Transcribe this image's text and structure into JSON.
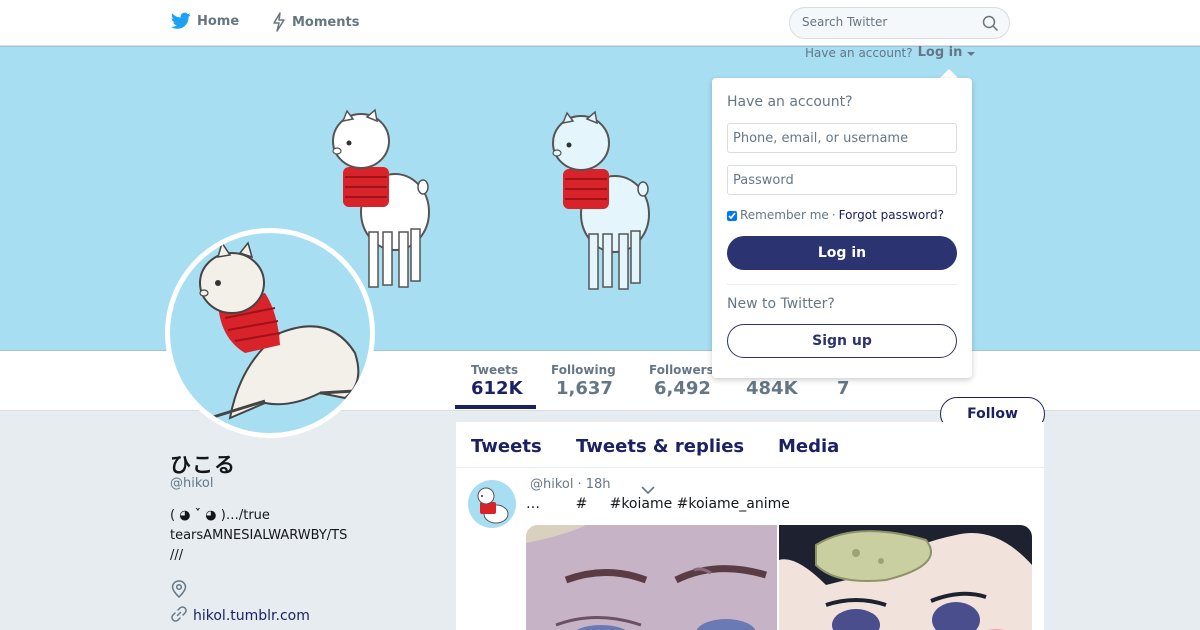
{
  "nav": {
    "home_label": "Home",
    "moments_label": "Moments"
  },
  "search": {
    "placeholder": "Search Twitter"
  },
  "stats": [
    {
      "label": "Tweets",
      "value": "612K"
    },
    {
      "label": "Following",
      "value": "1,637"
    },
    {
      "label": "Followers",
      "value": "6,492"
    },
    {
      "label": "",
      "value": "484K"
    },
    {
      "label": "",
      "value": "7"
    }
  ],
  "follow_label": "Follow",
  "profile": {
    "name": "ひこる",
    "handle": "@hikol",
    "bio_lines": [
      "( ◕ ˊ̀ ◕ )…/true",
      "tearsAMNESIALWARWBY/TS",
      "///"
    ],
    "link": "hikol.tumblr.com"
  },
  "timeline": {
    "tabs": [
      "Tweets",
      "Tweets & replies",
      "Media"
    ],
    "tweet": {
      "handle": "@hikol",
      "time": "· 18h",
      "text": "…        #     #koiame #koiame_anime"
    }
  },
  "login": {
    "prompt": "Have an account?",
    "link": "Log in",
    "dropdown_heading": "Have an account?",
    "username_placeholder": "Phone, email, or username",
    "password_placeholder": "Password",
    "remember_label": "Remember me",
    "separator": "·",
    "forgot_label": "Forgot password?",
    "login_button": "Log in",
    "new_heading": "New to Twitter?",
    "signup_button": "Sign up"
  },
  "colors": {
    "banner": "#a7def2",
    "accent": "#1b2163",
    "login_button": "#2c3371"
  },
  "icons": [
    "twitter-bird-icon",
    "moments-icon",
    "search-icon",
    "location-icon",
    "link-icon",
    "chevron-down-icon"
  ]
}
